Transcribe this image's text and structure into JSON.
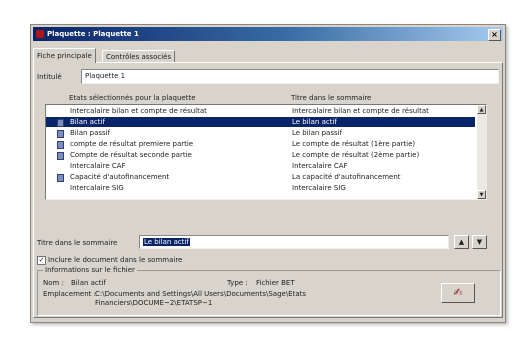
{
  "window": {
    "title": "Plaquette : Plaquette 1",
    "close": "×"
  },
  "tabs": [
    {
      "label": "Fiche principale"
    },
    {
      "label": "Contrôles associés"
    }
  ],
  "intitule": {
    "label": "Intitulé",
    "value": "Plaquette 1"
  },
  "list": {
    "col1": "Etats sélectionnés pour la plaquette",
    "col2": "Titre dans le sommaire",
    "rows": [
      {
        "name": "Intercalaire bilan et compte de résultat",
        "title": "Intercalaire bilan et compte de résultat"
      },
      {
        "name": "Bilan actif",
        "title": "Le bilan actif"
      },
      {
        "name": "Bilan passif",
        "title": "Le bilan passif"
      },
      {
        "name": "compte de résultat premiere partie",
        "title": "Le compte de résultat (1ère partie)"
      },
      {
        "name": "Compte de résultat seconde partie",
        "title": "Le compte de résultat (2ème partie)"
      },
      {
        "name": "Intercalaire CAF",
        "title": "Intercalaire CAF"
      },
      {
        "name": "Capacité d'autofinancement",
        "title": "La capacité d'autofinancement"
      },
      {
        "name": "Intercalaire SIG",
        "title": "Intercalaire SIG"
      }
    ],
    "selected_index": 1
  },
  "titre_sommaire": {
    "label": "Titre dans le sommaire",
    "value": "Le bilan actif"
  },
  "include": {
    "label": "Inclure le document dans le sommaire",
    "checked": true
  },
  "info": {
    "legend": "Informations sur le fichier",
    "nom_label": "Nom :",
    "nom_value": "Bilan actif",
    "type_label": "Type :",
    "type_value": "Fichier BET",
    "emplacement_label": "Emplacement :",
    "emplacement_line1": "C:\\Documents and Settings\\All Users\\Documents\\Sage\\Etats",
    "emplacement_line2": "Financiers\\DOCUME~2\\ETATSP~1"
  },
  "colors": {
    "titlebar": "#0a246a",
    "selection": "#0a246a",
    "window_bg": "#d8d4cc"
  },
  "icons": {
    "app": "app-icon",
    "row": "document-icon",
    "edit": "signature-edit-icon"
  }
}
